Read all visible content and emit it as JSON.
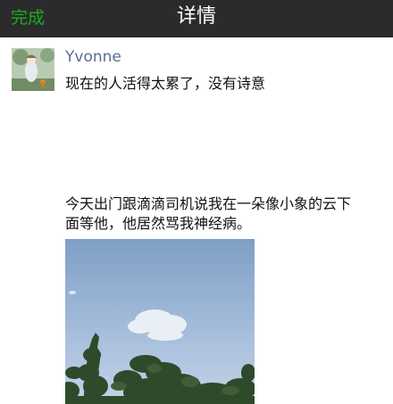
{
  "nav": {
    "done_label": "完成",
    "title": "详情"
  },
  "post": {
    "username": "Yvonne",
    "text": "现在的人活得太累了，没有诗意",
    "caption_line1": "今天出门跟滴滴司机说我在一朵像小象的云下",
    "caption_line2": "面等他，他居然骂我神经病。"
  },
  "icons": {
    "avatar": "avatar-illustration",
    "photo": "sky-cloud-trees-photo"
  },
  "colors": {
    "nav_background": "#2b2b2d",
    "done_green": "#1aad19",
    "username_blue": "#5a6c93"
  }
}
